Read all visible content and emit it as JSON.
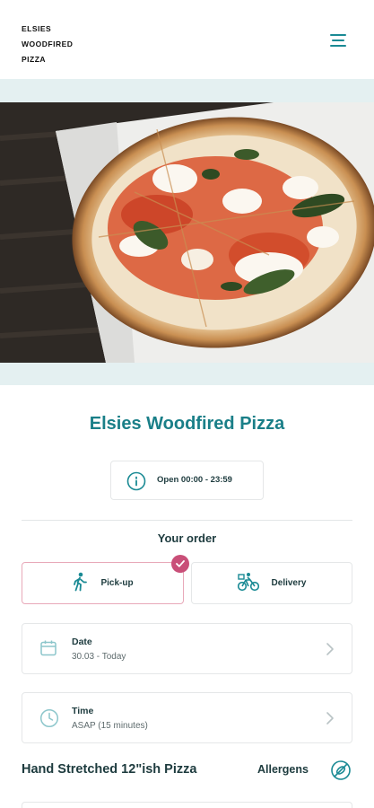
{
  "header": {
    "logo_text": "ELSIES\nWOODFIRED\nPIZZA",
    "menu_icon": "hamburger-menu-icon"
  },
  "hero": {
    "image": "margherita-pizza-photo"
  },
  "restaurant": {
    "name": "Elsies Woodfired Pizza",
    "hours": "Open 00:00 - 23:59"
  },
  "order": {
    "heading": "Your order",
    "modes": [
      {
        "label": "Pick-up",
        "icon": "walking-person-icon",
        "selected": true
      },
      {
        "label": "Delivery",
        "icon": "bicycle-courier-icon",
        "selected": false
      }
    ],
    "date": {
      "label": "Date",
      "value": "30.03 - Today",
      "icon": "calendar-icon"
    },
    "time": {
      "label": "Time",
      "value": "ASAP (15 minutes)",
      "icon": "clock-icon"
    }
  },
  "menu_section": {
    "title": "Hand Stretched 12\"ish Pizza",
    "allergens_label": "Allergens",
    "allergens_icon": "no-allergens-icon"
  },
  "colors": {
    "accent": "#1a7f88",
    "band": "#e4f0f1",
    "selected_border": "#e8a9b9",
    "badge": "#c94f78"
  }
}
